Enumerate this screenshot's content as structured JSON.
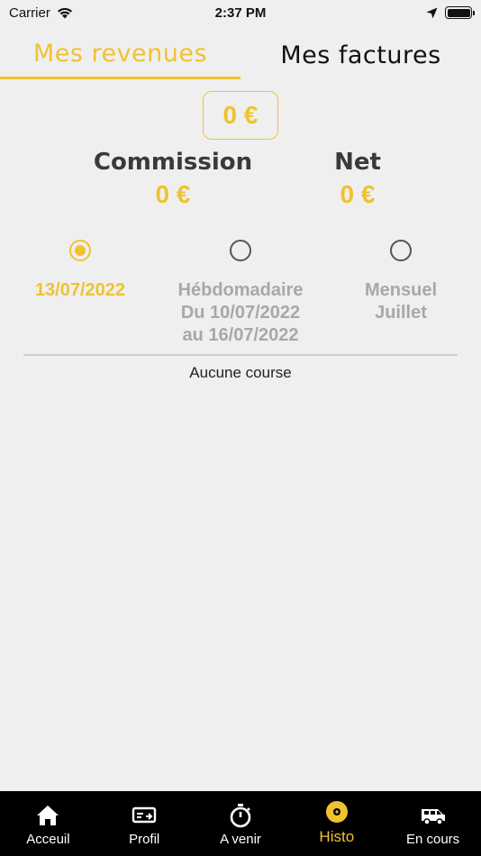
{
  "status_bar": {
    "carrier": "Carrier",
    "time": "2:37 PM"
  },
  "top_tabs": [
    {
      "label": "Mes revenues",
      "active": true
    },
    {
      "label": "Mes factures",
      "active": false
    }
  ],
  "summary": {
    "total": "0 €",
    "commission_label": "Commission",
    "commission_value": "0 €",
    "net_label": "Net",
    "net_value": "0 €"
  },
  "periods": [
    {
      "lines": [
        "13/07/2022"
      ],
      "selected": true
    },
    {
      "lines": [
        "Hébdomadaire",
        "Du 10/07/2022",
        "au 16/07/2022"
      ],
      "selected": false
    },
    {
      "lines": [
        "Mensuel",
        "Juillet"
      ],
      "selected": false
    }
  ],
  "empty_message": "Aucune course",
  "bottom_nav": [
    {
      "label": "Acceuil",
      "icon": "home-icon"
    },
    {
      "label": "Profil",
      "icon": "profile-card-icon"
    },
    {
      "label": "A venir",
      "icon": "stopwatch-icon"
    },
    {
      "label": "Histo",
      "icon": "disc-icon",
      "active": true
    },
    {
      "label": "En cours",
      "icon": "van-icon"
    }
  ],
  "colors": {
    "accent": "#f0c22f",
    "background": "#efefef",
    "nav_background": "#000000"
  }
}
